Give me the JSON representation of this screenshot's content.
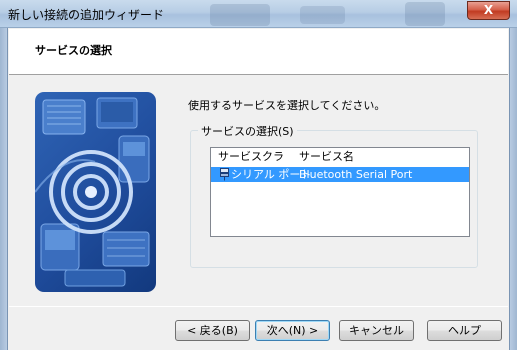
{
  "window": {
    "title": "新しい接続の追加ウィザード",
    "close_glyph": "X"
  },
  "header": {
    "title": "サービスの選択"
  },
  "content": {
    "instruction": "使用するサービスを選択してください。",
    "group_label": "サービスの選択(S)",
    "list": {
      "columns": [
        "サービスクラス",
        "サービス名"
      ],
      "rows": [
        {
          "service_class": "シリアル ポート",
          "service_name": "Bluetooth Serial Port",
          "selected": true,
          "icon": "serial-port-icon"
        }
      ]
    }
  },
  "buttons": {
    "back": "< 戻る(B)",
    "next": "次へ(N) >",
    "cancel": "キャンセル",
    "help": "ヘルプ"
  },
  "colors": {
    "selection": "#3399ff",
    "illustration": "#1f4c9c"
  }
}
